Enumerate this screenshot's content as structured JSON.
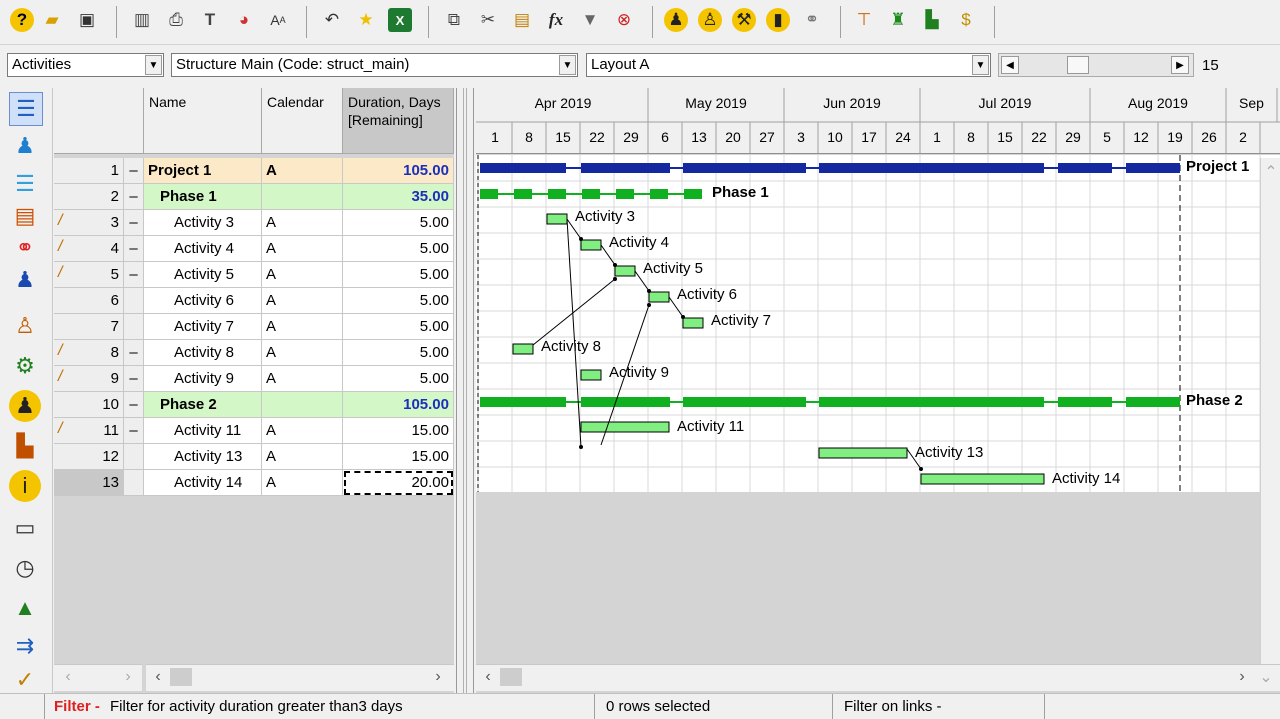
{
  "toolbar": {
    "icons": [
      "help-icon",
      "open-folder-icon",
      "save-icon",
      "columns-icon",
      "print-icon",
      "filter-columns-icon",
      "pie-chart-icon",
      "font-size-icon",
      "undo-icon",
      "star-icon",
      "excel-icon",
      "copy-icon",
      "cut-icon",
      "paste-icon",
      "formula-icon",
      "filter-icon",
      "clear-filter-icon",
      "resource-walk-icon",
      "resource-person-icon",
      "resource-tool-icon",
      "resource-material-icon",
      "link-icon",
      "org-structure-icon",
      "structure-color-icon",
      "chart-bars-icon",
      "money-icon"
    ]
  },
  "combos": {
    "view": "Activities",
    "structure": "Structure Main (Code: struct_main)",
    "layout": "Layout A",
    "zoom_value": "15"
  },
  "columns": {
    "name": "Name",
    "calendar": "Calendar",
    "duration": "Duration, Days",
    "duration_sub": "[Remaining]"
  },
  "rows": [
    {
      "num": "1",
      "collapse": "–",
      "name": "Project 1",
      "calendar": "A",
      "duration": "105.00",
      "level": "project",
      "edit": false
    },
    {
      "num": "2",
      "collapse": "–",
      "name": "Phase 1",
      "calendar": "",
      "duration": "35.00",
      "level": "phase",
      "edit": false
    },
    {
      "num": "3",
      "collapse": "–",
      "name": "Activity 3",
      "calendar": "A",
      "duration": "5.00",
      "level": "activity",
      "edit": true
    },
    {
      "num": "4",
      "collapse": "–",
      "name": "Activity 4",
      "calendar": "A",
      "duration": "5.00",
      "level": "activity",
      "edit": true
    },
    {
      "num": "5",
      "collapse": "–",
      "name": "Activity 5",
      "calendar": "A",
      "duration": "5.00",
      "level": "activity",
      "edit": true
    },
    {
      "num": "6",
      "collapse": "",
      "name": "Activity 6",
      "calendar": "A",
      "duration": "5.00",
      "level": "activity",
      "edit": false
    },
    {
      "num": "7",
      "collapse": "",
      "name": "Activity 7",
      "calendar": "A",
      "duration": "5.00",
      "level": "activity",
      "edit": false
    },
    {
      "num": "8",
      "collapse": "–",
      "name": "Activity 8",
      "calendar": "A",
      "duration": "5.00",
      "level": "activity",
      "edit": true
    },
    {
      "num": "9",
      "collapse": "–",
      "name": "Activity 9",
      "calendar": "A",
      "duration": "5.00",
      "level": "activity",
      "edit": true
    },
    {
      "num": "10",
      "collapse": "–",
      "name": "Phase 2",
      "calendar": "",
      "duration": "105.00",
      "level": "phase",
      "edit": false
    },
    {
      "num": "11",
      "collapse": "–",
      "name": "Activity 11",
      "calendar": "A",
      "duration": "15.00",
      "level": "activity",
      "edit": true
    },
    {
      "num": "12",
      "collapse": "",
      "name": "Activity 13",
      "calendar": "A",
      "duration": "15.00",
      "level": "activity",
      "edit": false
    },
    {
      "num": "13",
      "collapse": "",
      "name": "Activity 14",
      "calendar": "A",
      "duration": "20.00",
      "level": "activity",
      "edit": false,
      "selected": true
    }
  ],
  "gantt": {
    "months": [
      "Apr 2019",
      "May 2019",
      "Jun 2019",
      "Jul 2019",
      "Aug 2019",
      "Sep"
    ],
    "weeks": [
      "1",
      "8",
      "15",
      "22",
      "29",
      "6",
      "13",
      "20",
      "27",
      "3",
      "10",
      "17",
      "24",
      "1",
      "8",
      "15",
      "22",
      "29",
      "5",
      "12",
      "19",
      "26",
      "2"
    ],
    "bar_labels": {
      "r1": "Project 1",
      "r2": "Phase 1",
      "r3": "Activity 3",
      "r4": "Activity 4",
      "r5": "Activity 5",
      "r6": "Activity 6",
      "r7": "Activity 7",
      "r8": "Activity 8",
      "r9": "Activity 9",
      "r10": "Phase 2",
      "r11": "Activity 11",
      "r12": "Activity 13",
      "r13": "Activity 14"
    }
  },
  "status": {
    "filter_label": "Filter -",
    "filter_text": "Filter for activity duration greater than3 days",
    "rows_selected": "0 rows selected",
    "link_filter": "Filter on links -"
  },
  "colors": {
    "project_bar": "#1428a0",
    "phase_bar": "#10b020",
    "activity_bar": "#80ee80",
    "project_row_bg": "#fbe9c8",
    "phase_row_bg": "#d4f7c8",
    "filter_red": "#e02020",
    "duration_blue": "#1c2fb8"
  }
}
